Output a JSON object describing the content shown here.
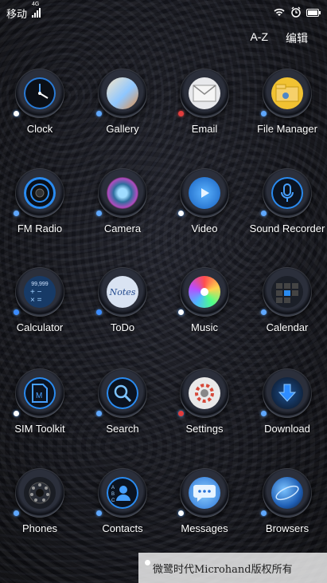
{
  "status": {
    "carrier": "移动",
    "network": "4G"
  },
  "top": {
    "sort": "A-Z",
    "edit": "编辑"
  },
  "apps": [
    {
      "id": "clock",
      "label": "Clock"
    },
    {
      "id": "gallery",
      "label": "Gallery"
    },
    {
      "id": "email",
      "label": "Email"
    },
    {
      "id": "file-manager",
      "label": "File Manager"
    },
    {
      "id": "fm-radio",
      "label": "FM Radio"
    },
    {
      "id": "camera",
      "label": "Camera"
    },
    {
      "id": "video",
      "label": "Video"
    },
    {
      "id": "sound-recorder",
      "label": "Sound Recorder"
    },
    {
      "id": "calculator",
      "label": "Calculator",
      "display": "99,999"
    },
    {
      "id": "todo",
      "label": "ToDo",
      "icon_text": "Notes"
    },
    {
      "id": "music",
      "label": "Music"
    },
    {
      "id": "calendar",
      "label": "Calendar"
    },
    {
      "id": "sim-toolkit",
      "label": "SIM Toolkit"
    },
    {
      "id": "search",
      "label": "Search"
    },
    {
      "id": "settings",
      "label": "Settings"
    },
    {
      "id": "download",
      "label": "Download"
    },
    {
      "id": "phones",
      "label": "Phones"
    },
    {
      "id": "contacts",
      "label": "Contacts"
    },
    {
      "id": "messages",
      "label": "Messages"
    },
    {
      "id": "browsers",
      "label": "Browsers"
    }
  ],
  "watermark": "微鹭时代Microhand版权所有"
}
